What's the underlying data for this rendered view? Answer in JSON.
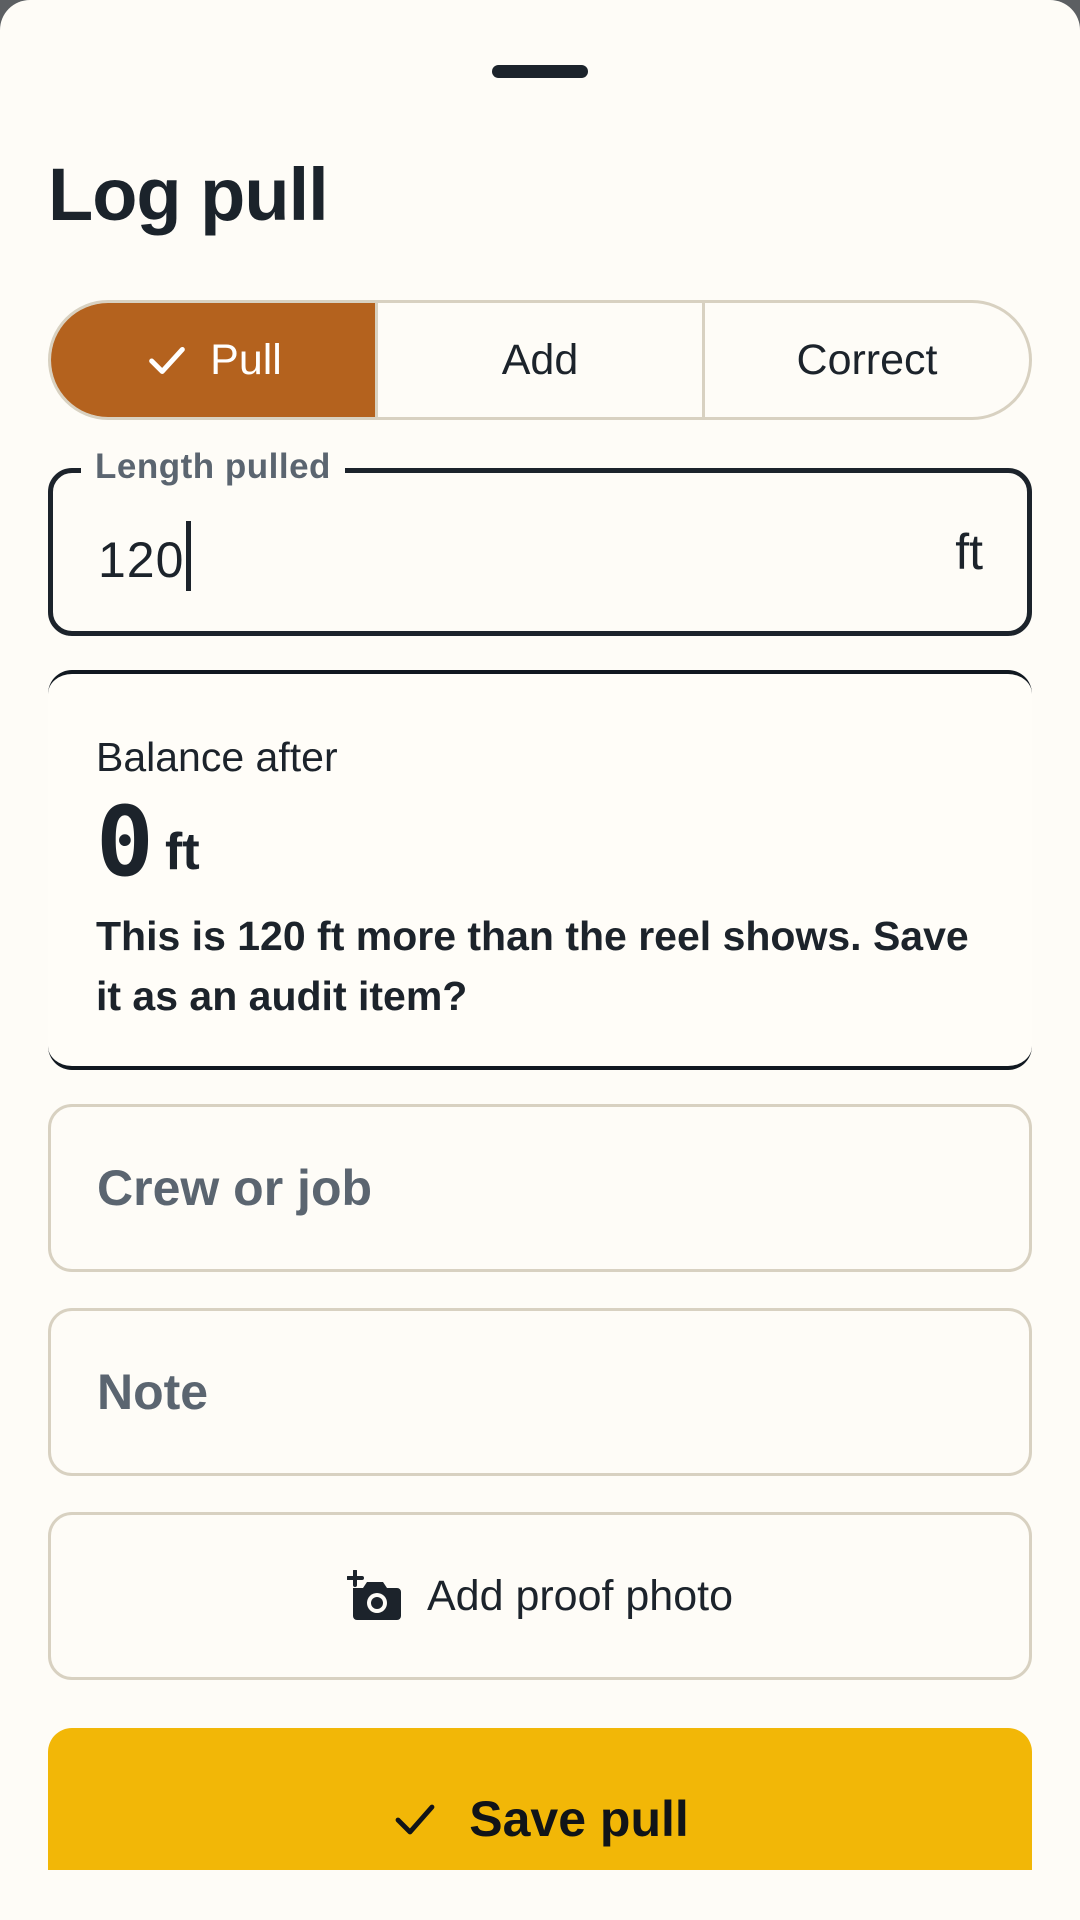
{
  "sheet": {
    "title": "Log pull"
  },
  "mode_tabs": {
    "options": [
      "Pull",
      "Add",
      "Correct"
    ],
    "selected": "Pull",
    "active_color": "#b4621e"
  },
  "length_field": {
    "label": "Length pulled",
    "value": "120",
    "unit": "ft"
  },
  "balance": {
    "label": "Balance after",
    "value": "0",
    "unit": "ft",
    "message": "This is 120 ft more than the reel shows. Save it as an audit item?"
  },
  "crew_field": {
    "placeholder": "Crew or job"
  },
  "note_field": {
    "placeholder": "Note"
  },
  "photo_button": {
    "label": "Add proof photo",
    "icon": "add-camera-icon"
  },
  "save_button": {
    "label": "Save pull",
    "icon": "check-icon",
    "color": "#f2b707"
  }
}
